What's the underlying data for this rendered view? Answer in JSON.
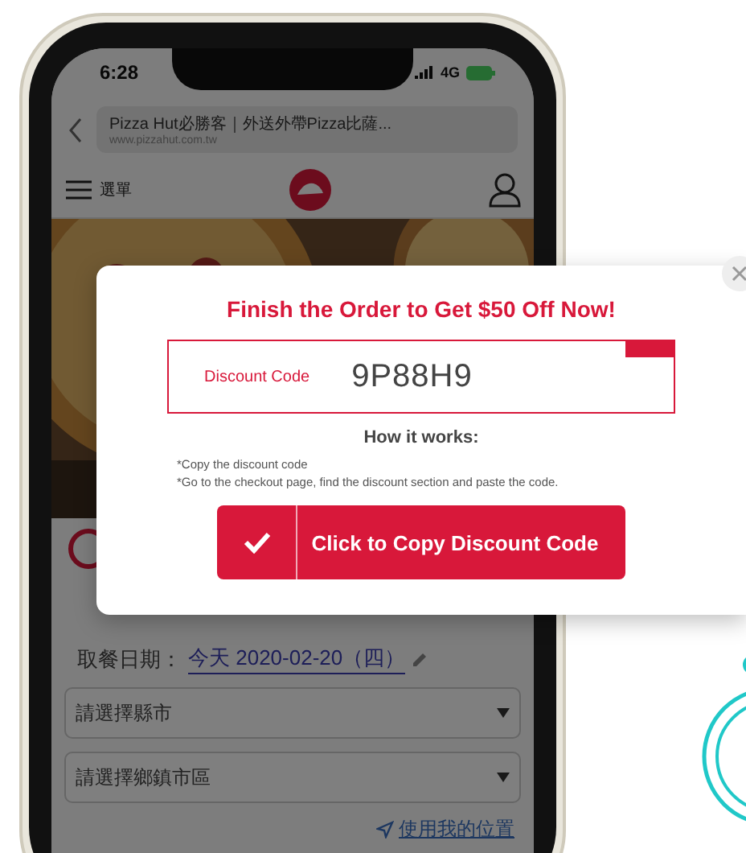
{
  "status_bar": {
    "time": "6:28",
    "network": "4G"
  },
  "browser": {
    "page_title": "Pizza Hut必勝客｜外送外帶Pizza比薩...",
    "url": "www.pizzahut.com.tw"
  },
  "nav": {
    "menu_label": "選單"
  },
  "pickup": {
    "label": "取餐日期：",
    "value": "今天 2020-02-20（四）"
  },
  "selects": [
    {
      "label": "請選擇縣市"
    },
    {
      "label": "請選擇鄉鎮市區"
    }
  ],
  "location_link": "使用我的位置",
  "popup": {
    "title": "Finish the Order to Get $50 Off Now!",
    "code_label": "Discount Code",
    "code": "9P88H9",
    "instructions_title": "How it works:",
    "instructions": [
      "*Copy the discount code",
      "*Go to the checkout page, find the discount section and paste the code."
    ],
    "button": "Click to Copy Discount Code"
  }
}
